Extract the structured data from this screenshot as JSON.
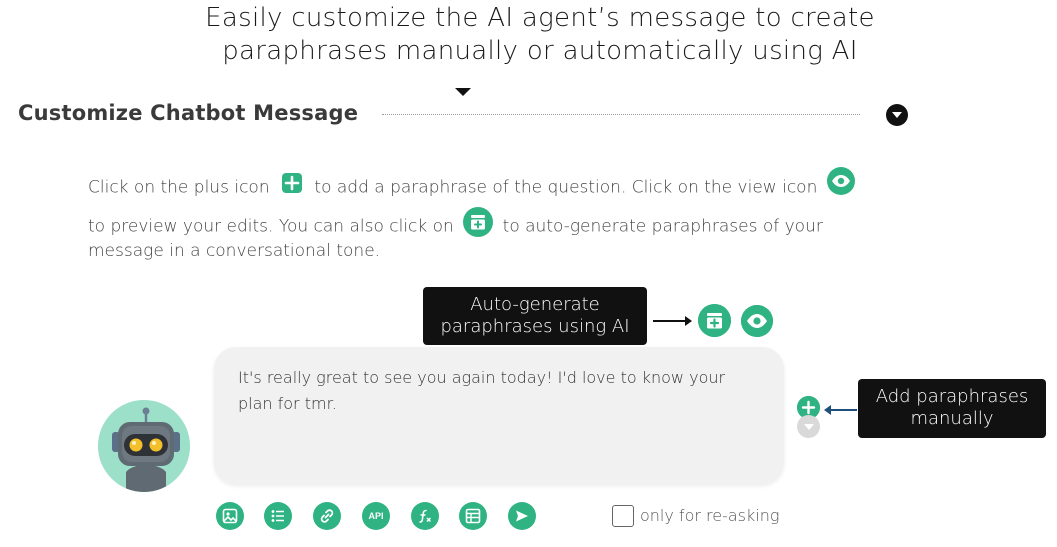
{
  "headline": {
    "line1": "Easily customize the AI agent’s message to create",
    "line2": "paraphrases manually or automatically using AI"
  },
  "section": {
    "title": "Customize Chatbot Message"
  },
  "instructions": {
    "part1": "Click on the plus icon",
    "part2": "to add a paraphrase of the question. Click on the view icon",
    "part3": "to preview your edits. You can also click on",
    "part4": "to auto-generate paraphrases of your",
    "part5": "message in a conversational tone."
  },
  "callouts": {
    "auto_generate": {
      "line1": "Auto-generate",
      "line2": "paraphrases using AI"
    },
    "manual": {
      "line1": "Add paraphrases",
      "line2": "manually"
    }
  },
  "message": {
    "text": "It's really great to see you again today! I'd love to know your plan for tmr."
  },
  "toolbar": {
    "api_label": "API",
    "icons": [
      "image-icon",
      "list-icon",
      "link-icon",
      "api-icon",
      "function-icon",
      "table-icon",
      "send-icon"
    ]
  },
  "options": {
    "only_reasking_label": "only for re-asking",
    "only_reasking_checked": false
  },
  "colors": {
    "accent": "#2fb383",
    "bubble": "#f1f1f1",
    "callout": "#111111",
    "avatar_bg": "#9ce0c9"
  }
}
